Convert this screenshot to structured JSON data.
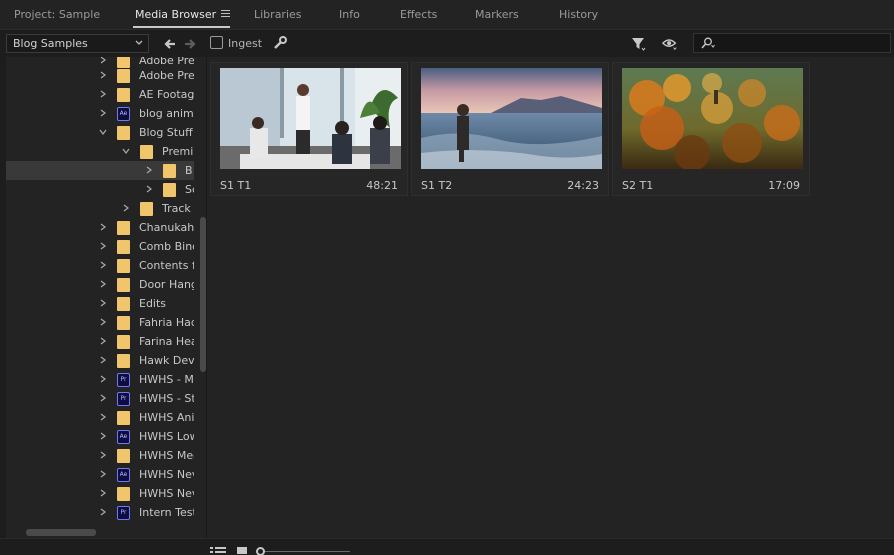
{
  "tabs": [
    {
      "label": "Project: Sample"
    },
    {
      "label": "Media Browser"
    },
    {
      "label": "Libraries"
    },
    {
      "label": "Info"
    },
    {
      "label": "Effects"
    },
    {
      "label": "Markers"
    },
    {
      "label": "History"
    }
  ],
  "active_tab": "Media Browser",
  "toolbar": {
    "location": "Blog Samples",
    "ingest_label": "Ingest",
    "search_value": "",
    "icons": [
      "back-arrow-icon",
      "forward-arrow-icon",
      "wrench-icon",
      "filter-icon",
      "eye-icon",
      "search-icon"
    ]
  },
  "tree": {
    "items": [
      {
        "label": "Adobe Prer",
        "type": "folder"
      },
      {
        "label": "Adobe Prer",
        "type": "folder"
      },
      {
        "label": "AE Footage",
        "type": "folder"
      },
      {
        "label": "blog anima",
        "type": "ae",
        "badge": "Ae"
      },
      {
        "label": "Blog Stuff",
        "type": "folder"
      },
      {
        "label": "Premi",
        "type": "folder"
      },
      {
        "label": "B",
        "type": "folder"
      },
      {
        "label": "Sc",
        "type": "folder"
      },
      {
        "label": "Track",
        "type": "folder"
      },
      {
        "label": "Chanukah",
        "type": "folder"
      },
      {
        "label": "Comb Bind",
        "type": "folder"
      },
      {
        "label": "Contents fc",
        "type": "folder"
      },
      {
        "label": "Door Hange",
        "type": "folder"
      },
      {
        "label": "Edits",
        "type": "folder"
      },
      {
        "label": "Fahria Haq",
        "type": "folder"
      },
      {
        "label": "Farina Hea",
        "type": "folder"
      },
      {
        "label": "Hawk Deve",
        "type": "folder"
      },
      {
        "label": "HWHS - Me",
        "type": "pr",
        "badge": "Pr"
      },
      {
        "label": "HWHS - Stu",
        "type": "pr",
        "badge": "Pr"
      },
      {
        "label": "HWHS Anin",
        "type": "folder"
      },
      {
        "label": "HWHS Low",
        "type": "ae",
        "badge": "Ae"
      },
      {
        "label": "HWHS Mec",
        "type": "folder"
      },
      {
        "label": "HWHS Nev",
        "type": "ae",
        "badge": "Ae"
      },
      {
        "label": "HWHS Nev",
        "type": "folder"
      },
      {
        "label": "Intern Test",
        "type": "pr",
        "badge": "Pr"
      }
    ]
  },
  "clips": [
    {
      "name": "S1 T1",
      "duration": "48:21"
    },
    {
      "name": "S1 T2",
      "duration": "24:23"
    },
    {
      "name": "S2 T1",
      "duration": "17:09"
    }
  ],
  "colors": {
    "panel": "#232323",
    "folder": "#f1c56b",
    "badge_border": "#6f7af0",
    "badge_fill": "#0d0d42"
  }
}
